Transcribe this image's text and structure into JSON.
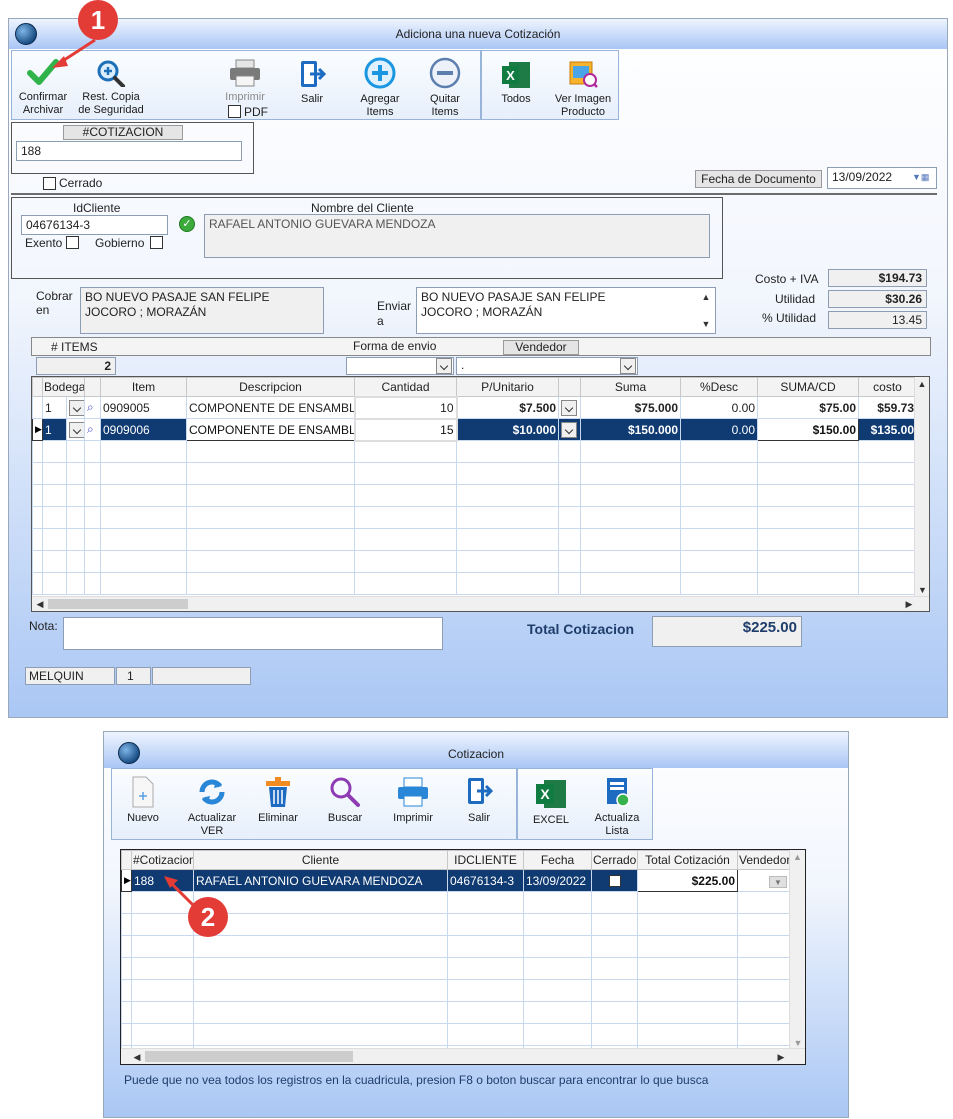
{
  "win1": {
    "title": "Adiciona una nueva Cotización",
    "toolbar": {
      "confirm": "Confirmar\nArchivar",
      "restore": "Rest. Copia\nde Seguridad",
      "print": "Imprimir",
      "pdf": "PDF",
      "exit": "Salir",
      "add": "Agregar\nItems",
      "remove": "Quitar\nItems",
      "all": "Todos",
      "view_image": "Ver Imagen\nProducto"
    },
    "quote_label": "#COTIZACION",
    "quote_number": "188",
    "closed_label": "Cerrado",
    "date_label": "Fecha de  Documento",
    "date_value": "13/09/2022",
    "client_id_label": "IdCliente",
    "client_id": "04676134-3",
    "client_name_label": "Nombre del Cliente",
    "client_name": "RAFAEL ANTONIO GUEVARA MENDOZA",
    "exempt_label": "Exento",
    "government_label": "Gobierno",
    "charge_label": "Cobrar\nen",
    "charge_address": "BO NUEVO PASAJE SAN FELIPE\nJOCORO ; MORAZÁN",
    "send_label": "Enviar\na",
    "send_address": "BO NUEVO PASAJE SAN FELIPE\nJOCORO ; MORAZÁN",
    "cost_label": "Costo + IVA",
    "cost_value": "$194.73",
    "utility_label": "Utilidad",
    "utility_value": "$30.26",
    "pct_label": "% Utilidad",
    "pct_value": "13.45",
    "items_label": "# ITEMS",
    "items_count": "2",
    "shipping_label": "Forma de envio",
    "seller_label": "Vendedor",
    "seller_value": ".",
    "grid_headers": [
      "Bodega",
      "",
      "Item",
      "Descripcion",
      "Cantidad",
      "P/Unitario",
      "",
      "Suma",
      "%Desc",
      "SUMA/CD",
      "costo"
    ],
    "rows": [
      {
        "bodega": "1",
        "item": "0909005",
        "desc": "COMPONENTE DE ENSAMBL",
        "qty": "10",
        "price": "$7.500",
        "sum": "$75.000",
        "disc": "0.00",
        "sumcd": "$75.00",
        "cost": "$59.73"
      },
      {
        "bodega": "1",
        "item": "0909006",
        "desc": "COMPONENTE DE ENSAMBL",
        "qty": "15",
        "price": "$10.000",
        "sum": "$150.000",
        "disc": "0.00",
        "sumcd": "$150.00",
        "cost": "$135.00"
      }
    ],
    "note_label": "Nota:",
    "total_label": "Total Cotizacion",
    "total_value": "$225.00",
    "status": [
      "MELQUIN",
      "1",
      ""
    ]
  },
  "win2": {
    "title": "Cotizacion",
    "toolbar": {
      "new": "Nuevo",
      "refresh": "Actualizar\nVER",
      "delete": "Eliminar",
      "search": "Buscar",
      "print": "Imprimir",
      "exit": "Salir",
      "excel": "EXCEL",
      "update_list": "Actualiza\nLista"
    },
    "grid_headers": [
      "#Cotizacion",
      "Cliente",
      "IDCLIENTE",
      "Fecha",
      "Cerrado",
      "Total Cotización",
      "Vendedor"
    ],
    "row": {
      "num": "188",
      "client": "RAFAEL ANTONIO GUEVARA MENDOZA",
      "id": "04676134-3",
      "date": "13/09/2022",
      "total": "$225.00"
    },
    "hint": "Puede que no vea todos los registros en la cuadricula, presion F8 o boton buscar para encontrar lo que busca"
  },
  "annotations": [
    "1",
    "2"
  ],
  "colors": {
    "accent": "#0f3a72",
    "badge": "#e33b36"
  }
}
